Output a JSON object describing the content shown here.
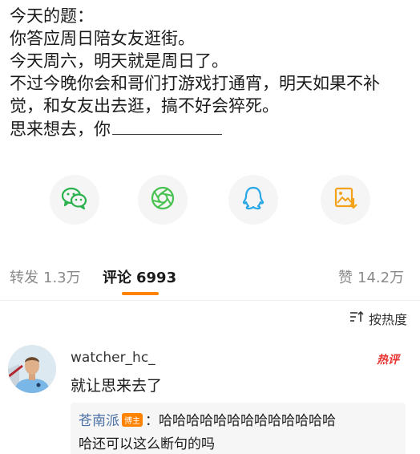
{
  "post": {
    "lines": [
      "今天的题：",
      "你答应周日陪女友逛街。",
      "今天周六，明天就是周日了。",
      "不过今晚你会和哥们打游戏打通宵，明天如果不补",
      "觉，和女友出去逛，搞不好会猝死。",
      "思来想去，你"
    ]
  },
  "share": {
    "icons": [
      "wechat-icon",
      "moments-icon",
      "qq-icon",
      "save-image-icon"
    ],
    "colors": {
      "wechat": "#2ab14e",
      "moments": "#47c14f",
      "qq": "#27a6e5",
      "save": "#f3a21a"
    }
  },
  "tabs": {
    "repost": {
      "label": "转发",
      "count": "1.3万"
    },
    "comments": {
      "label": "评论",
      "count": "6993"
    },
    "likes": {
      "label": "赞",
      "count": "14.2万"
    }
  },
  "sort": {
    "label": "按热度"
  },
  "comment": {
    "username": "watcher_hc_",
    "badge": "热评",
    "text": "就让思来去了",
    "reply": {
      "author": "苍南派",
      "owner_badge": "博主",
      "line1": "：哈哈哈哈哈哈哈哈哈哈哈哈哈",
      "line2": "哈还可以这么断句的吗"
    }
  },
  "colors": {
    "accent": "#ff8200",
    "hot": "#e8322f",
    "link": "#4a6fa5"
  }
}
